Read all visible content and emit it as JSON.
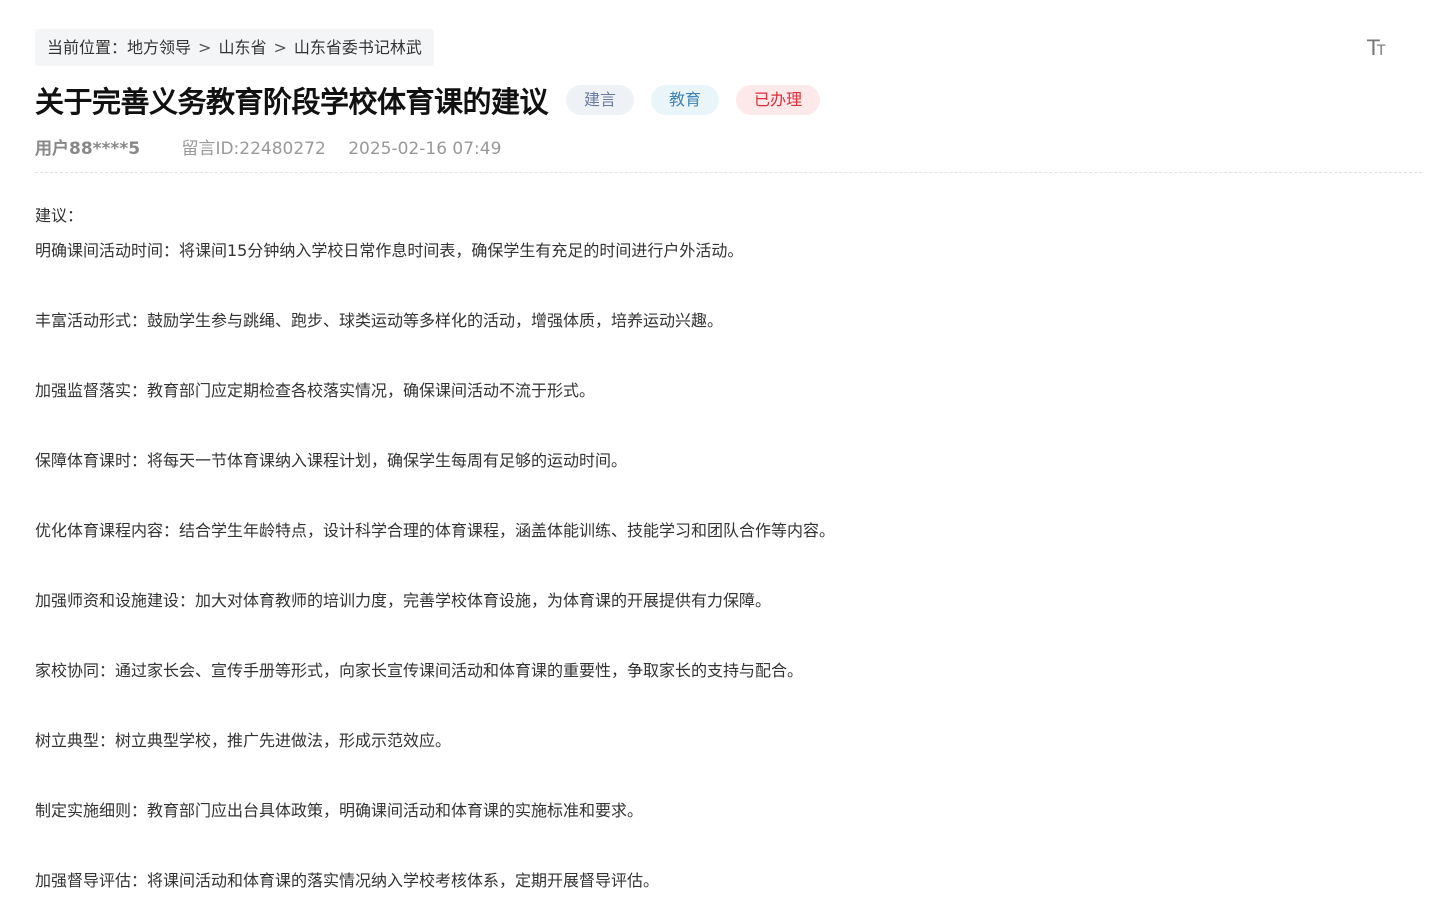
{
  "breadcrumb": {
    "prefix": "当前位置：",
    "items": [
      "地方领导",
      "山东省",
      "山东省委书记林武"
    ],
    "separator": ">"
  },
  "toolbar": {
    "font_size_icon": "text-size-icon",
    "font_size_glyph_big": "T",
    "font_size_glyph_small": "T"
  },
  "post": {
    "title": "关于完善义务教育阶段学校体育课的建议",
    "tags": [
      {
        "label": "建言",
        "bg": "#eef1f6",
        "color": "#6a7ba0"
      },
      {
        "label": "教育",
        "bg": "#e9f5f9",
        "color": "#3f82b3"
      },
      {
        "label": "已办理",
        "bg": "#fde8ea",
        "color": "#d9303c"
      }
    ],
    "user": "用户88****5",
    "message_id": "留言ID:22480272",
    "date": "2025-02-16 07:49"
  },
  "content": {
    "intro": "建议：",
    "paragraphs": [
      "明确课间活动时间：将课间15分钟纳入学校日常作息时间表，确保学生有充足的时间进行户外活动。",
      "丰富活动形式：鼓励学生参与跳绳、跑步、球类运动等多样化的活动，增强体质，培养运动兴趣。",
      "加强监督落实：教育部门应定期检查各校落实情况，确保课间活动不流于形式。",
      "保障体育课时：将每天一节体育课纳入课程计划，确保学生每周有足够的运动时间。",
      "优化体育课程内容：结合学生年龄特点，设计科学合理的体育课程，涵盖体能训练、技能学习和团队合作等内容。",
      "加强师资和设施建设：加大对体育教师的培训力度，完善学校体育设施，为体育课的开展提供有力保障。",
      "家校协同：通过家长会、宣传手册等形式，向家长宣传课间活动和体育课的重要性，争取家长的支持与配合。",
      "树立典型：树立典型学校，推广先进做法，形成示范效应。",
      "制定实施细则：教育部门应出台具体政策，明确课间活动和体育课的实施标准和要求。",
      "加强督导评估：将课间活动和体育课的落实情况纳入学校考核体系，定期开展督导评估。"
    ]
  }
}
